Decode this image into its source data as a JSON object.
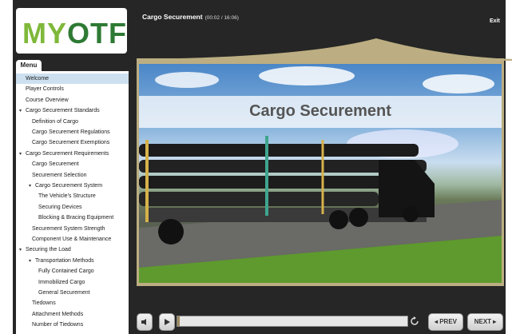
{
  "logo": {
    "text_m": "M",
    "text_y": "Y",
    "text_otf": "OTF"
  },
  "menu": {
    "tab_label": "Menu",
    "items": [
      {
        "label": "Welcome",
        "selected": true,
        "indent": 1,
        "caret": ""
      },
      {
        "label": "Player Controls",
        "indent": 1,
        "caret": ""
      },
      {
        "label": "Course Overview",
        "indent": 1,
        "caret": ""
      },
      {
        "label": "Cargo Securement Standards",
        "indent": 0,
        "caret": "▾"
      },
      {
        "label": "Definition of Cargo",
        "indent": 2,
        "caret": ""
      },
      {
        "label": "Cargo Securement Regulations",
        "indent": 2,
        "caret": ""
      },
      {
        "label": "Cargo Securement Exemptions",
        "indent": 2,
        "caret": ""
      },
      {
        "label": "Cargo Securement Requirements",
        "indent": 0,
        "caret": "▾"
      },
      {
        "label": "Cargo Securement",
        "indent": 2,
        "caret": ""
      },
      {
        "label": "Securement Selection",
        "indent": 2,
        "caret": ""
      },
      {
        "label": "Cargo Securement System",
        "indent": 1.5,
        "caret": "▾"
      },
      {
        "label": "The Vehicle's Structure",
        "indent": 3,
        "caret": ""
      },
      {
        "label": "Securing Devices",
        "indent": 3,
        "caret": ""
      },
      {
        "label": "Blocking & Bracing Equipment",
        "indent": 3,
        "caret": ""
      },
      {
        "label": "Securement System Strength",
        "indent": 2,
        "caret": ""
      },
      {
        "label": "Component Use & Maintenance",
        "indent": 2,
        "caret": ""
      },
      {
        "label": "Securing the Load",
        "indent": 0,
        "caret": "▾"
      },
      {
        "label": "Transportation Methods",
        "indent": 1.5,
        "caret": "▾"
      },
      {
        "label": "Fully Contained Cargo",
        "indent": 3,
        "caret": ""
      },
      {
        "label": "Immobilized Cargo",
        "indent": 3,
        "caret": ""
      },
      {
        "label": "General Securement",
        "indent": 3,
        "caret": ""
      },
      {
        "label": "Tiedowns",
        "indent": 2,
        "caret": ""
      },
      {
        "label": "Attachment Methods",
        "indent": 2,
        "caret": ""
      },
      {
        "label": "Number of Tiedowns",
        "indent": 2,
        "caret": ""
      }
    ]
  },
  "header": {
    "title": "Cargo Securement",
    "time": "(00:02 / 16:06)",
    "exit_label": "Exit"
  },
  "video": {
    "title": "Cargo Securement",
    "progress_fraction": 0.01
  },
  "controls": {
    "prev_label": "◂ PREV",
    "next_label": "NEXT ▸",
    "volume_icon": "speaker-icon",
    "play_icon": "play-icon",
    "replay_icon": "replay-icon"
  }
}
